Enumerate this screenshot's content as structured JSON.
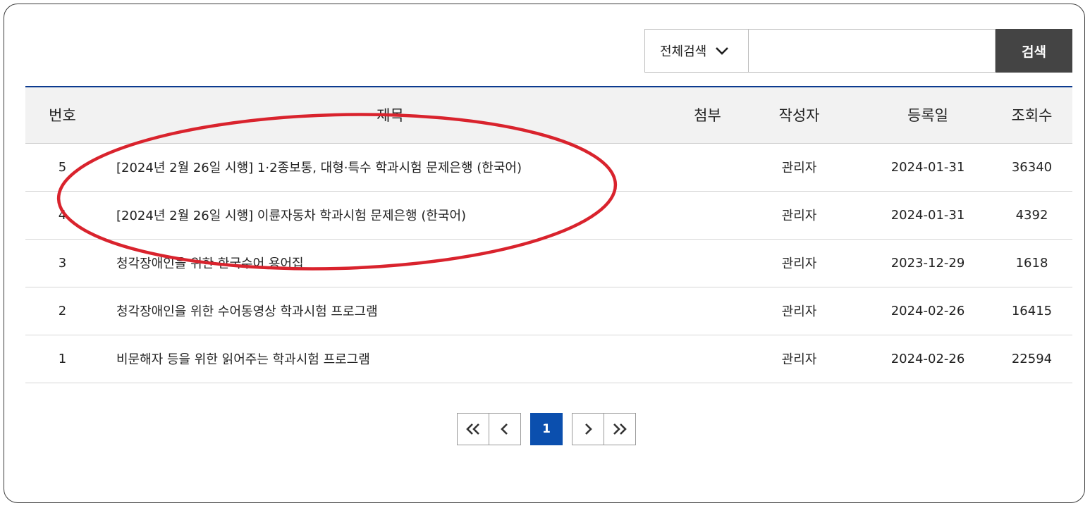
{
  "search": {
    "scope_label": "전체검색",
    "query": "",
    "button_label": "검색"
  },
  "table": {
    "columns": [
      "번호",
      "제목",
      "첨부",
      "작성자",
      "등록일",
      "조회수"
    ],
    "rows": [
      {
        "no": "5",
        "title": "[2024년 2월 26일 시행] 1·2종보통, 대형·특수 학과시험 문제은행 (한국어)",
        "attach": "",
        "author": "관리자",
        "date": "2024-01-31",
        "views": "36340"
      },
      {
        "no": "4",
        "title": "[2024년 2월 26일 시행] 이륜자동차 학과시험 문제은행 (한국어)",
        "attach": "",
        "author": "관리자",
        "date": "2024-01-31",
        "views": "4392"
      },
      {
        "no": "3",
        "title": "청각장애인을 위한 한국수어 용어집",
        "attach": "",
        "author": "관리자",
        "date": "2023-12-29",
        "views": "1618"
      },
      {
        "no": "2",
        "title": "청각장애인을 위한 수어동영상 학과시험 프로그램",
        "attach": "",
        "author": "관리자",
        "date": "2024-02-26",
        "views": "16415"
      },
      {
        "no": "1",
        "title": "비문해자 등을 위한 읽어주는 학과시험 프로그램",
        "attach": "",
        "author": "관리자",
        "date": "2024-02-26",
        "views": "22594"
      }
    ]
  },
  "pagination": {
    "current_page": "1"
  },
  "colors": {
    "table_top_border": "#0c3a8f",
    "search_button": "#444444",
    "active_page": "#0b4fae",
    "annotation_ellipse": "#d9232d"
  },
  "icons": {
    "dropdown": "chevron-down-icon",
    "first": "double-chevron-left-icon",
    "prev": "chevron-left-icon",
    "next": "chevron-right-icon",
    "last": "double-chevron-right-icon"
  }
}
